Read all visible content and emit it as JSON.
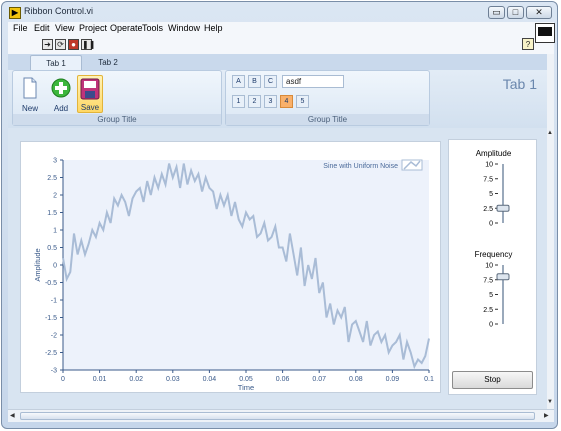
{
  "window": {
    "title": "Ribbon Control.vi"
  },
  "menu": [
    "File",
    "Edit",
    "View",
    "Project",
    "Operate",
    "Tools",
    "Window",
    "Help"
  ],
  "toolbar": {
    "run_icon": "run-arrow-icon",
    "run_cont_icon": "run-continuously-icon",
    "abort_icon": "abort-icon",
    "pause_icon": "pause-icon",
    "help_label": "?"
  },
  "ribbon": {
    "tabs": [
      "Tab 1",
      "Tab 2"
    ],
    "active_tab": "Tab 1",
    "big_label": "Tab 1",
    "group1": {
      "title": "Group Title",
      "buttons": [
        "New",
        "Add",
        "Save"
      ]
    },
    "group2": {
      "title": "Group Title",
      "letters": [
        "A",
        "B",
        "C"
      ],
      "text_value": "asdf",
      "numbers": [
        "1",
        "2",
        "3",
        "4",
        "5"
      ],
      "selected_number": "4"
    }
  },
  "controls": {
    "amplitude": {
      "label": "Amplitude",
      "ticks": [
        "10",
        "7.5",
        "5",
        "2.5",
        "0"
      ],
      "value": 2.5
    },
    "frequency": {
      "label": "Frequency",
      "ticks": [
        "10",
        "7.5",
        "5",
        "2.5",
        "0"
      ],
      "value": 8
    },
    "stop_label": "Stop"
  },
  "colors": {
    "plot_line": "#a9bcd6",
    "accent": "#f9b06a",
    "plot_bg": "#edf2fb"
  },
  "chart_data": {
    "type": "line",
    "title": "",
    "xlabel": "Time",
    "ylabel": "Amplitude",
    "legend": {
      "label": "Sine with Uniform Noise",
      "position": "top-right"
    },
    "xlim": [
      0,
      0.1
    ],
    "ylim": [
      -3,
      3
    ],
    "x_ticks": [
      "0",
      "0.01",
      "0.02",
      "0.03",
      "0.04",
      "0.05",
      "0.06",
      "0.07",
      "0.08",
      "0.09",
      "0.1"
    ],
    "y_ticks": [
      "3",
      "2.5",
      "2",
      "1.5",
      "1",
      "0.5",
      "0",
      "-0.5",
      "-1",
      "-1.5",
      "-2",
      "-2.5",
      "-3"
    ],
    "series": [
      {
        "name": "Sine with Uniform Noise",
        "x": [
          0,
          0.001,
          0.002,
          0.003,
          0.004,
          0.005,
          0.006,
          0.007,
          0.008,
          0.009,
          0.01,
          0.011,
          0.012,
          0.013,
          0.014,
          0.015,
          0.016,
          0.017,
          0.018,
          0.019,
          0.02,
          0.021,
          0.022,
          0.023,
          0.024,
          0.025,
          0.026,
          0.027,
          0.028,
          0.029,
          0.03,
          0.031,
          0.032,
          0.033,
          0.034,
          0.035,
          0.036,
          0.037,
          0.038,
          0.039,
          0.04,
          0.041,
          0.042,
          0.043,
          0.044,
          0.045,
          0.046,
          0.047,
          0.048,
          0.049,
          0.05,
          0.051,
          0.052,
          0.053,
          0.054,
          0.055,
          0.056,
          0.057,
          0.058,
          0.059,
          0.06,
          0.061,
          0.062,
          0.063,
          0.064,
          0.065,
          0.066,
          0.067,
          0.068,
          0.069,
          0.07,
          0.071,
          0.072,
          0.073,
          0.074,
          0.075,
          0.076,
          0.077,
          0.078,
          0.079,
          0.08,
          0.081,
          0.082,
          0.083,
          0.084,
          0.085,
          0.086,
          0.087,
          0.088,
          0.089,
          0.09,
          0.091,
          0.092,
          0.093,
          0.094,
          0.095,
          0.096,
          0.097,
          0.098,
          0.099,
          0.1
        ],
        "y": [
          0.2,
          -0.4,
          -0.2,
          0.9,
          0.3,
          0.7,
          0.3,
          0.6,
          1.0,
          0.8,
          1.2,
          1.0,
          1.5,
          1.2,
          1.9,
          1.7,
          2.0,
          1.8,
          1.4,
          1.9,
          2.1,
          2.2,
          1.8,
          2.4,
          2.0,
          2.5,
          2.2,
          2.6,
          2.3,
          2.9,
          2.5,
          2.8,
          2.2,
          2.9,
          2.3,
          2.7,
          2.4,
          2.6,
          2.1,
          2.5,
          2.2,
          2.1,
          1.6,
          2.0,
          1.7,
          2.0,
          1.4,
          1.8,
          1.3,
          1.1,
          1.5,
          1.3,
          1.4,
          0.8,
          0.9,
          1.2,
          0.7,
          0.8,
          1.1,
          0.5,
          0.5,
          0.1,
          0.9,
          0.3,
          -0.3,
          0.5,
          -0.6,
          0.0,
          -0.4,
          0.2,
          -0.8,
          -0.5,
          -1.5,
          -1.1,
          -1.7,
          -1.3,
          -1.5,
          -1.2,
          -2.2,
          -1.7,
          -1.6,
          -1.9,
          -2.2,
          -1.6,
          -2.3,
          -2.0,
          -1.9,
          -2.2,
          -2.0,
          -2.5,
          -2.3,
          -2.2,
          -2.0,
          -2.7,
          -2.2,
          -2.5,
          -2.9,
          -2.7,
          -2.8,
          -2.6,
          -2.1
        ]
      }
    ]
  }
}
